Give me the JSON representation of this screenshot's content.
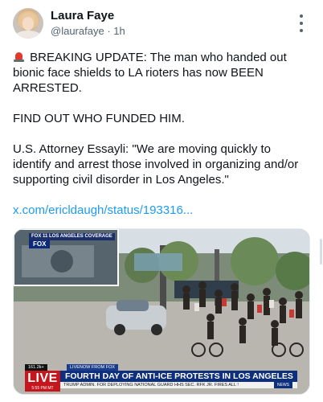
{
  "author": {
    "name": "Laura Faye",
    "handle": "@laurafaye",
    "separator": "·",
    "time": "1h"
  },
  "post": {
    "line1": "BREAKING UPDATE: The man who handed out bionic face shields to LA rioters has now BEEN ARRESTED.",
    "line2": "FIND OUT WHO FUNDED HIM.",
    "line3": "U.S. Attorney Essayli: \"We are moving quickly to identify and arrest those involved in organizing and/or supporting civil disorder in Los Angeles.\"",
    "link": "x.com/ericldaugh/status/193316..."
  },
  "icons": {
    "emoji": "police-siren-icon",
    "more": "more-vertical-icon"
  },
  "colors": {
    "link": "#1d9bf0",
    "text": "#0f1419",
    "secondary": "#536471",
    "live_red": "#c4161c",
    "fox_blue": "#0e2f7d"
  },
  "media": {
    "inset_label": "FOX 11 LOS ANGELES COVERAGE",
    "inset_logo": "FOX",
    "live_label": "LIVE",
    "channel_bug": "161.2k+",
    "livenow": "LIVENOW FROM FOX",
    "headline": "FOURTH DAY OF ANTI-ICE PROTESTS IN LOS ANGELES",
    "time": "5:55 PM MT",
    "ticker": "TRUMP ADMIN. FOR DEPLOYING NATIONAL GUARD  HHS SEC. RFK JR. FIRES ALL !",
    "ticker_tag": "NEWS"
  }
}
